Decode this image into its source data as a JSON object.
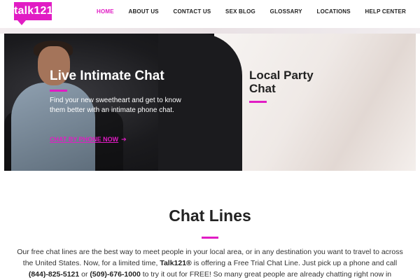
{
  "brand": {
    "logo_text": "talk121",
    "accent_color": "#e11cc4"
  },
  "nav": {
    "items": [
      "HOME",
      "ABOUT US",
      "CONTACT US",
      "SEX BLOG",
      "GLOSSARY",
      "LOCATIONS",
      "HELP CENTER"
    ],
    "active": "HOME"
  },
  "hero": {
    "left": {
      "title": "Live Intimate Chat",
      "description": "Find your new sweetheart and get to know them better with an intimate phone chat.",
      "cta": "CHAT BY PHONE NOW",
      "cta_icon": "arrow-right-icon"
    },
    "right": {
      "title": "Local Party Chat"
    }
  },
  "section": {
    "title": "Chat Lines",
    "p1": "Our free chat lines are the best way to meet people in your local area, or in any destination you want to travel to across the United States. Now, for a limited time, ",
    "brand": "Talk121®",
    "p2": " is offering a Free Trial Chat Line. Just pick up a phone and call ",
    "phone1": "(844)-825-5121",
    "or": " or ",
    "phone2": "(509)-676-1000",
    "p3": " to try it out for FREE! So many great people are already chatting right now in"
  }
}
